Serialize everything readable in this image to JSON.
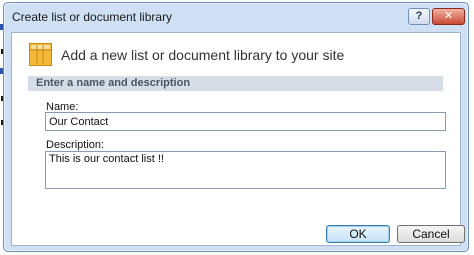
{
  "dialog": {
    "title": "Create list or document library",
    "help_glyph": "?",
    "close_glyph": "✕",
    "heading": "Add a new list or document library to your site",
    "icon": "list-table-icon",
    "section_label": "Enter a name and description",
    "name_label": "Name:",
    "name_value": "Our Contact",
    "description_label": "Description:",
    "description_value": "This is our contact list !!",
    "ok_label": "OK",
    "cancel_label": "Cancel"
  },
  "colors": {
    "frame": "#cfe0f4",
    "icon_fill": "#f3b73a",
    "section_bar": "#d6dde6",
    "ok_focus": "#3c7fb1"
  }
}
